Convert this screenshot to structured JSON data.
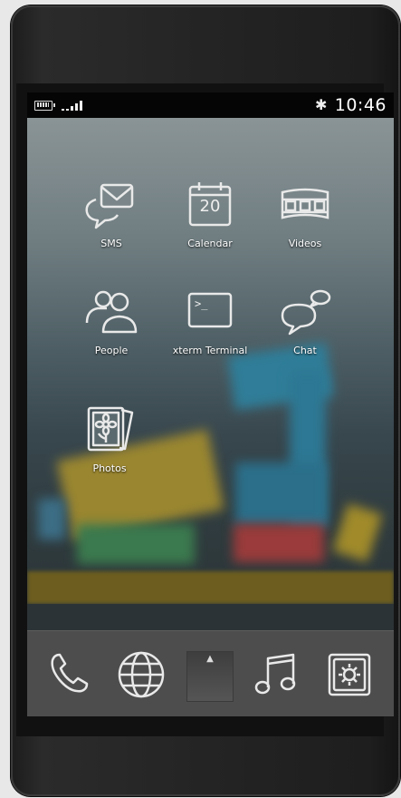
{
  "status_bar": {
    "battery_icon": "battery-icon",
    "signal_icon": "signal-icon",
    "bluetooth_icon": "bluetooth-icon",
    "bluetooth_glyph": "✱",
    "time": "10:46"
  },
  "home_apps": [
    {
      "label": "SMS",
      "icon": "sms-icon"
    },
    {
      "label": "Calendar",
      "icon": "calendar-icon",
      "day": "20"
    },
    {
      "label": "Videos",
      "icon": "film-icon"
    },
    {
      "label": "People",
      "icon": "people-icon"
    },
    {
      "label": "xterm Terminal",
      "icon": "terminal-icon",
      "prompt": ">_"
    },
    {
      "label": "Chat",
      "icon": "chat-bubbles-icon"
    },
    {
      "label": "Photos",
      "icon": "photos-icon"
    }
  ],
  "dock": {
    "items": [
      "phone-icon",
      "globe-icon",
      "app-drawer-handle",
      "music-icon",
      "settings-icon"
    ],
    "drawer_glyph": "▲"
  },
  "colors": {
    "dock_bg": "#4d4d4d",
    "status_bg": "#050505",
    "icon_stroke": "#e9e9e9"
  }
}
